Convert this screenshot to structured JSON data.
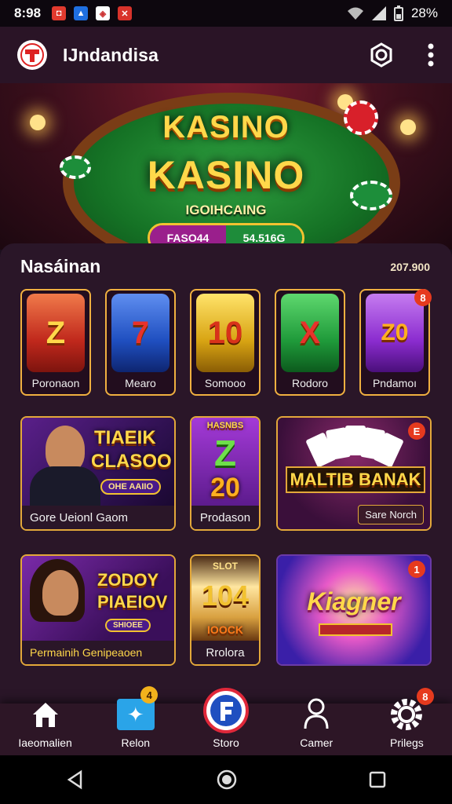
{
  "status_bar": {
    "time": "8:98",
    "battery": "28%"
  },
  "app_bar": {
    "title": "IJndandisa"
  },
  "hero": {
    "title_top": "KASINO",
    "title_main": "KASINO",
    "subtitle": "IGOIHCAING",
    "pill_left": "FASO44",
    "pill_right": "54.516G"
  },
  "section": {
    "title": "Nasáinan",
    "count": "207.900"
  },
  "slots": [
    {
      "symbol": "Z",
      "label": "Poronaon",
      "color": "#d0392b"
    },
    {
      "symbol": "7",
      "label": "Mearo",
      "color": "#1f55c8"
    },
    {
      "symbol": "10",
      "label": "Somooo",
      "color": "#d8a413"
    },
    {
      "symbol": "X",
      "label": "Rodoro",
      "color": "#1f9a3a"
    },
    {
      "symbol": "Z0",
      "label": "Pndamoı",
      "color": "#8b2ccf",
      "badge": "8"
    }
  ],
  "cards_row1": [
    {
      "art_top": "TIAEIK",
      "art_main": "CLASOO",
      "art_sub": "OHE AAIIO",
      "caption": "Gore Ueionl Gaom"
    },
    {
      "art_top": "HASNBS",
      "art_main": "Z",
      "art_main2": "20",
      "caption": "Prodason"
    },
    {
      "art_main": "MALTIB BANAK",
      "caption": "Sare Norch",
      "badge": "E"
    }
  ],
  "cards_row2": [
    {
      "art_top": "ZODOY",
      "art_main": "PIAEIOV",
      "art_sub": "SHIOEE",
      "caption": "Permainih Genipeaoen"
    },
    {
      "art_top": "SLOT",
      "art_main": "104",
      "art_sub": "IOOCK",
      "caption": "Rrolora"
    },
    {
      "art_main": "Kiagner",
      "badge": "1"
    }
  ],
  "bottom_nav": [
    {
      "label": "Iaeomalien",
      "icon": "home-icon"
    },
    {
      "label": "Relon",
      "icon": "bird-icon",
      "badge": "4"
    },
    {
      "label": "Storo",
      "icon": "store-icon"
    },
    {
      "label": "Camer",
      "icon": "person-icon"
    },
    {
      "label": "Prilegs",
      "icon": "gear-icon",
      "badge": "8"
    }
  ]
}
